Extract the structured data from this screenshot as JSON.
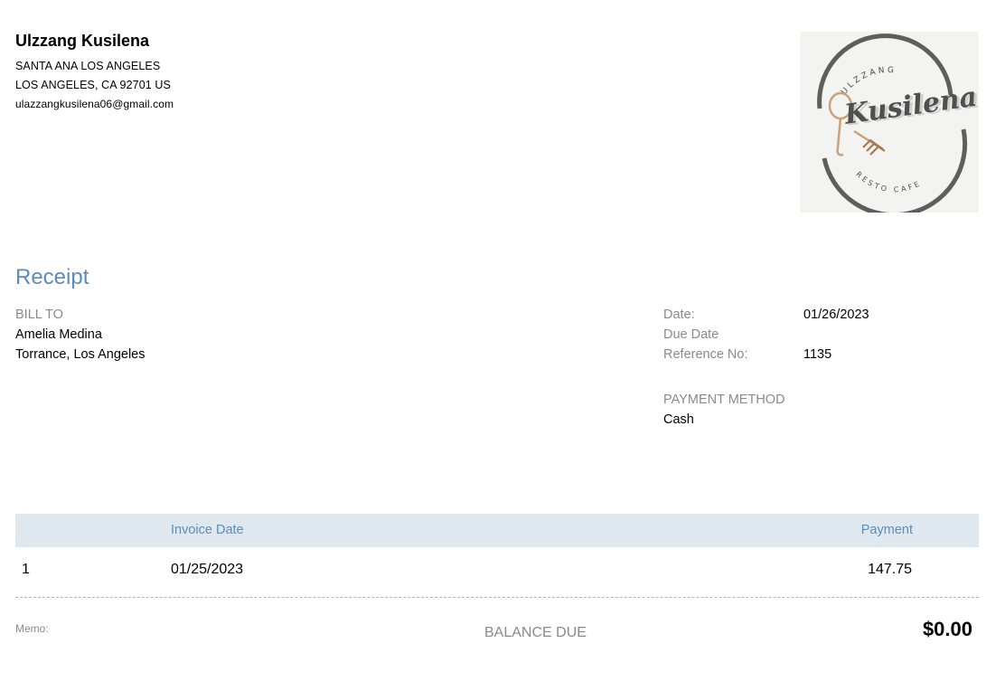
{
  "company": {
    "name": "Ulzzang Kusilena",
    "address_line1": "SANTA ANA LOS ANGELES",
    "address_line2": "LOS ANGELES, CA  92701 US",
    "email": "ulazzangkusilena06@gmail.com"
  },
  "logo": {
    "top_text": "ULZZANG",
    "script_text": "Kusilena",
    "bottom_text": "RESTO CAFE",
    "colors": {
      "ring": "#5e5e5e",
      "gold": "#c8a27a",
      "text": "#4a4a4a",
      "bg": "#f3f3f2"
    }
  },
  "document": {
    "title": "Receipt"
  },
  "bill_to": {
    "label": "BILL TO",
    "name": "Amelia Medina",
    "location": "Torrance, Los Angeles"
  },
  "meta": {
    "date_label": "Date:",
    "date_value": "01/26/2023",
    "due_label": "Due Date",
    "ref_label": "Reference No:",
    "ref_value": "1135",
    "payment_method_label": "PAYMENT METHOD",
    "payment_method_value": "Cash"
  },
  "table": {
    "headers": {
      "invoice_date": "Invoice Date",
      "payment": "Payment"
    },
    "rows": [
      {
        "num": "1",
        "invoice_date": "01/25/2023",
        "payment": "147.75"
      }
    ]
  },
  "footer": {
    "memo_label": "Memo:",
    "balance_label": "BALANCE DUE",
    "balance_value": "$0.00"
  },
  "colors": {
    "accent": "#5b8db8",
    "muted": "#8a8a8a",
    "header_bg": "#dfe8ef"
  }
}
